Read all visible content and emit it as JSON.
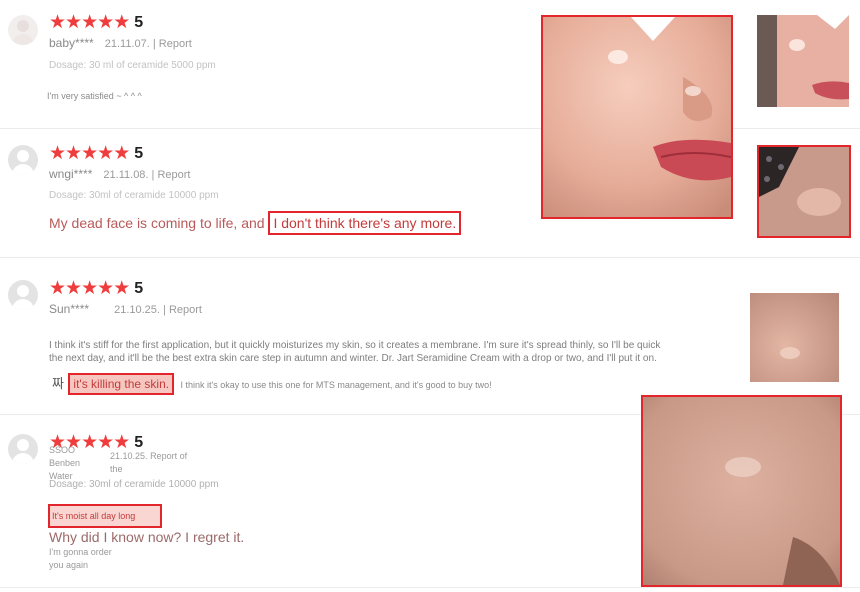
{
  "reviews": [
    {
      "user": "baby****",
      "date": "21.11.07.",
      "report": "| Report",
      "score": "5",
      "dosage": "Dosage: 30 ml of ceramide 5000 ppm",
      "text": "I'm very satisfied ~ ^ ^ ^"
    },
    {
      "user": "wngi****",
      "date": "21.11.08.",
      "report": "| Report",
      "score": "5",
      "dosage": "Dosage: 30ml of ceramide 10000 ppm",
      "text": "My dead face is coming to life, and",
      "highlight": "I don't think there's any more."
    },
    {
      "user": "Sun****",
      "date": "21.10.25.",
      "report": "| Report",
      "score": "5",
      "text_line1": "I think it's stiff for the first application, but it quickly moisturizes my skin, so it creates a membrane. I'm sure it's spread thinly, so I'll be quick",
      "text_line2": "the next day, and it'll be the best extra skin care step in autumn and winter. Dr. Jart Seramidine Cream with a drop or two, and I'll put it on.",
      "prefix": "짜",
      "highlight": "it's killing the skin.",
      "text_after": "I think it's okay to use this one for MTS management, and it's good to buy two!"
    },
    {
      "user_line1": "SSOO",
      "user_line2": "Benben",
      "user_line3": "Water",
      "date": "21.10.25.",
      "report_line1": "Report of",
      "report_line2": "the",
      "score": "5",
      "dosage": "Dosage: 30ml of ceramide 10000 ppm",
      "highlight": "It's moist all day long",
      "text_large": "Why did I know now? I regret it.",
      "text_small_line1": "I'm gonna order",
      "text_small_line2": "you again"
    }
  ],
  "stars_glyph": "★",
  "colors": {
    "star": "#ef3d3d",
    "highlight_border": "#e3262b"
  }
}
